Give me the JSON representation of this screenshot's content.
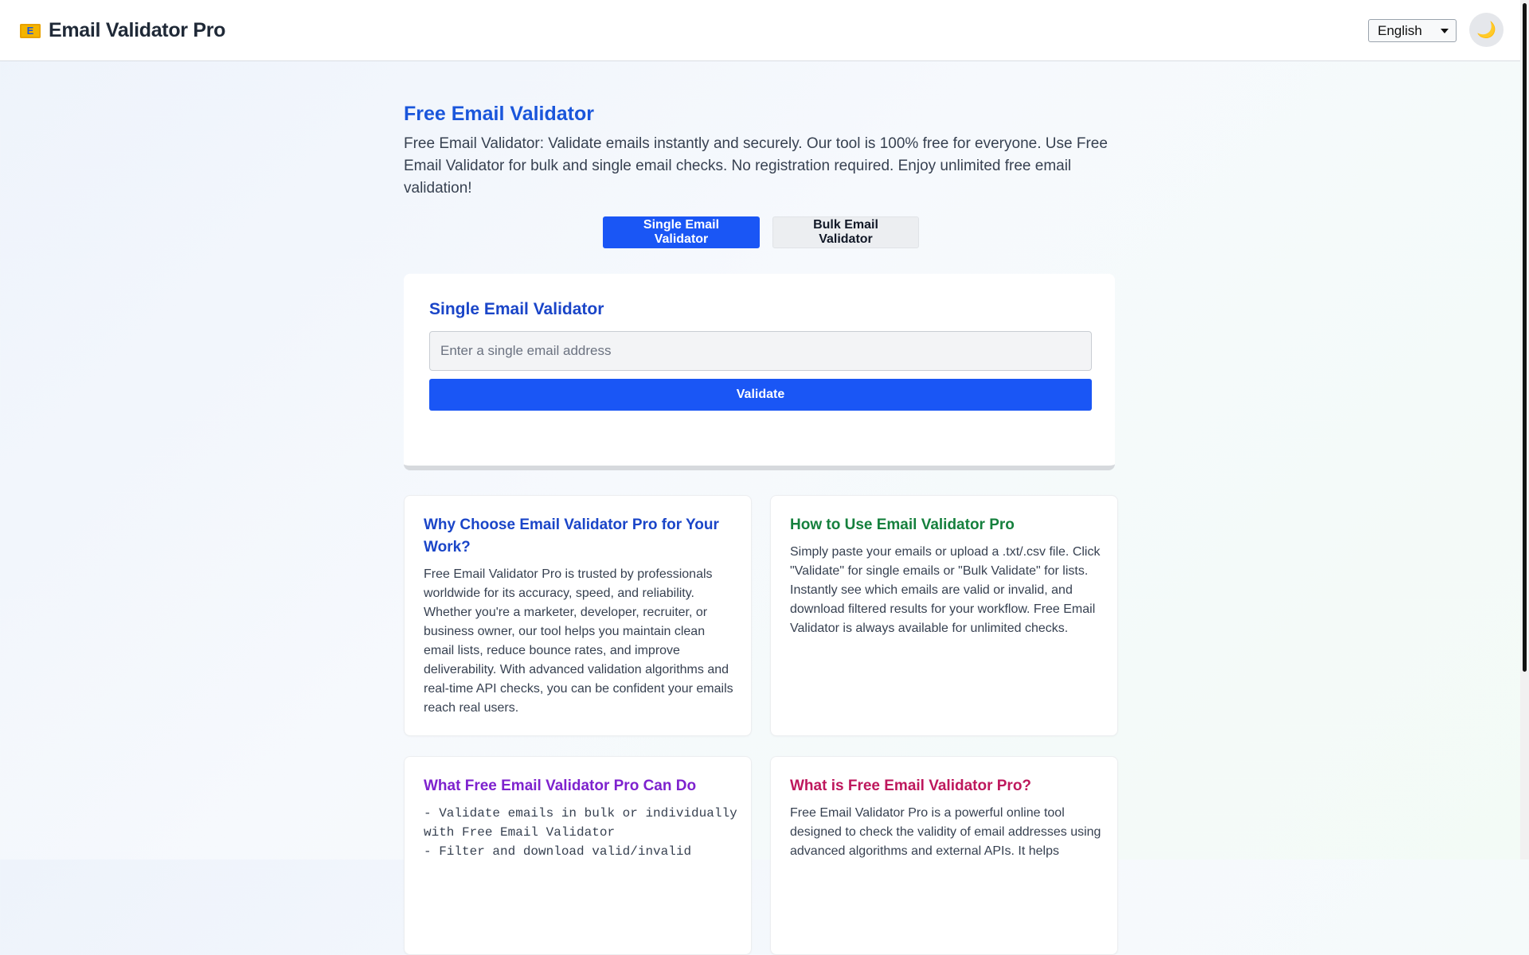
{
  "header": {
    "logo_glyph": "E",
    "brand_title": "Email Validator Pro",
    "language": "English",
    "theme_toggle_icon": "🌙",
    "colors": {
      "brand_bg": "#ffffff",
      "accent": "#1a56f5"
    }
  },
  "hero": {
    "title": "Free Email Validator",
    "description": "Free Email Validator: Validate emails instantly and securely. Our tool is 100% free for everyone. Use Free Email Validator for bulk and single email checks. No registration required. Enjoy unlimited free email validation!"
  },
  "tabs": [
    {
      "label": "Single Email Validator",
      "active": true
    },
    {
      "label": "Bulk Email Validator",
      "active": false
    }
  ],
  "validator": {
    "title": "Single Email Validator",
    "input_value": "",
    "input_placeholder": "Enter a single email address",
    "button_label": "Validate"
  },
  "info_cards": [
    {
      "title": "Why Choose Email Validator Pro for Your Work?",
      "title_color": "#1a45c8",
      "body": "Free Email Validator Pro is trusted by professionals worldwide for its accuracy, speed, and reliability. Whether you're a marketer, developer, recruiter, or business owner, our tool helps you maintain clean email lists, reduce bounce rates, and improve deliverability. With advanced validation algorithms and real-time API checks, you can be confident your emails reach real users."
    },
    {
      "title": "How to Use Email Validator Pro",
      "title_color": "#15803d",
      "body": "Simply paste your emails or upload a .txt/.csv file. Click \"Validate\" for single emails or \"Bulk Validate\" for lists. Instantly see which emails are valid or invalid, and download filtered results for your workflow. Free Email Validator is always available for unlimited checks."
    },
    {
      "title": "What Free Email Validator Pro Can Do",
      "title_color": "#7e22ce",
      "body": "- Validate emails in bulk or individually with Free Email Validator\n- Filter and download valid/invalid"
    },
    {
      "title": "What is Free Email Validator Pro?",
      "title_color": "#be185d",
      "body": "Free Email Validator Pro is a powerful online tool designed to check the validity of email addresses using advanced algorithms and external APIs. It helps"
    }
  ]
}
